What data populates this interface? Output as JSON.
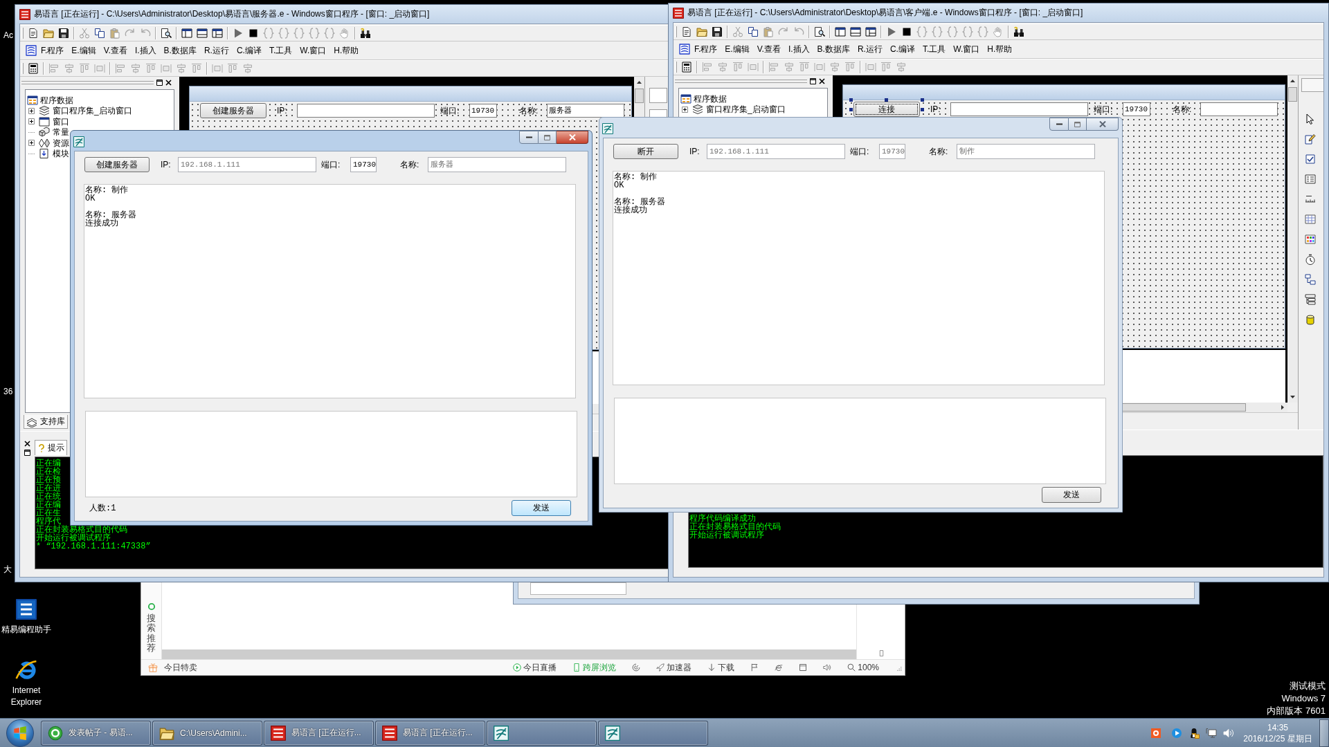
{
  "desktop": {
    "edge_labels": [
      "Ac",
      "36",
      "大"
    ],
    "icons": [
      {
        "label": "精易编程助手"
      },
      {
        "label": "Internet Explorer"
      }
    ],
    "test_mode_lines": [
      "测试模式",
      "Windows 7",
      "内部版本 7601"
    ]
  },
  "browser": {
    "sidebar_label": "搜索推荐",
    "promo_link": "今日特卖",
    "status_items": [
      {
        "label": "今日直播",
        "highlighted": false
      },
      {
        "label": "跨屏浏览",
        "highlighted": true
      },
      {
        "label": "加速器",
        "highlighted": false
      },
      {
        "label": "下载",
        "highlighted": false
      }
    ],
    "zoom_level": "100%"
  },
  "ide_windows": [
    {
      "title": "易语言 [正在运行] - C:\\Users\\Administrator\\Desktop\\易语言\\服务器.e - Windows窗口程序 - [窗口: _启动窗口]",
      "menu": [
        "F.程序",
        "E.编辑",
        "V.查看",
        "I.插入",
        "B.数据库",
        "R.运行",
        "C.编译",
        "T.工具",
        "W.窗口",
        "H.帮助"
      ],
      "tree": {
        "label": "程序数据",
        "children": [
          {
            "label": "窗口程序集_启动窗口",
            "expandable": true
          },
          {
            "label": "窗口",
            "expandable": true
          },
          {
            "label": "常量",
            "expandable": false
          },
          {
            "label": "资源",
            "expandable": true
          },
          {
            "label": "模块",
            "expandable": false
          }
        ]
      },
      "designer": {
        "button": "创建服务器",
        "button_selected": false,
        "fields": [
          {
            "label": "IP:"
          },
          {
            "label": "端口:",
            "value": "19730"
          },
          {
            "label": "名称:",
            "value": "服务器"
          }
        ]
      },
      "support_tab": "支持库",
      "hint_tab": "提示",
      "output_lines": [
        "正在编",
        "正在检",
        "正在预",
        "正在进",
        "正在统",
        "正在编",
        "正在生",
        "程序代",
        "正在封装易格式目的代码",
        "开始运行被调试程序",
        "* “192.168.1.111:47338”"
      ]
    },
    {
      "title": "易语言 [正在运行] - C:\\Users\\Administrator\\Desktop\\易语言\\客户端.e - Windows窗口程序 - [窗口: _启动窗口]",
      "menu": [
        "F.程序",
        "E.编辑",
        "V.查看",
        "I.插入",
        "B.数据库",
        "R.运行",
        "C.编译",
        "T.工具",
        "W.窗口",
        "H.帮助"
      ],
      "tree": {
        "label": "程序数据",
        "children": [
          {
            "label": "窗口程序集_启动窗口",
            "expandable": true
          }
        ]
      },
      "designer": {
        "button": "连接",
        "button_selected": true,
        "fields": [
          {
            "label": "IP:"
          },
          {
            "label": "端口:",
            "value": "19730"
          },
          {
            "label": "名称:"
          }
        ]
      },
      "output_lines": [
        "程序代码编译成功",
        "正在封装易格式目的代码",
        "开始运行被调试程序"
      ]
    }
  ],
  "dialogs": [
    {
      "active": true,
      "action_button": "创建服务器",
      "fields": [
        {
          "label": "IP:",
          "value": "192.168.1.111",
          "disabled": true
        },
        {
          "label": "端口:",
          "value": "19730",
          "disabled": false
        },
        {
          "label": "名称:",
          "value": "服务器",
          "disabled": true
        }
      ],
      "log_entries": [
        {
          "lines": [
            "名称: 制作",
            "OK"
          ]
        },
        {
          "lines": [
            "名称: 服务器",
            "连接成功"
          ]
        }
      ],
      "member_count": "人数:1",
      "send_button": {
        "label": "发送",
        "focused": true
      }
    },
    {
      "active": false,
      "action_button": "断开",
      "fields": [
        {
          "label": "IP:",
          "value": "192.168.1.111",
          "disabled": true
        },
        {
          "label": "端口:",
          "value": "19730",
          "disabled": true
        },
        {
          "label": "名称:",
          "value": "制作",
          "disabled": true
        }
      ],
      "log_entries": [
        {
          "lines": [
            "名称: 制作",
            "OK"
          ]
        },
        {
          "lines": [
            "名称: 服务器",
            "连接成功"
          ]
        }
      ],
      "send_button": {
        "label": "发送",
        "focused": false
      }
    }
  ],
  "taskbar": {
    "items": [
      {
        "kind": "browser",
        "label": "发表帖子 - 易语..."
      },
      {
        "kind": "folder",
        "label": "C:\\Users\\Admini..."
      },
      {
        "kind": "ide",
        "label": "易语言 [正在运行..."
      },
      {
        "kind": "ide",
        "label": "易语言 [正在运行..."
      },
      {
        "kind": "app"
      },
      {
        "kind": "app"
      }
    ],
    "clock": {
      "time": "14:35",
      "date": "2016/12/25 星期日"
    }
  }
}
